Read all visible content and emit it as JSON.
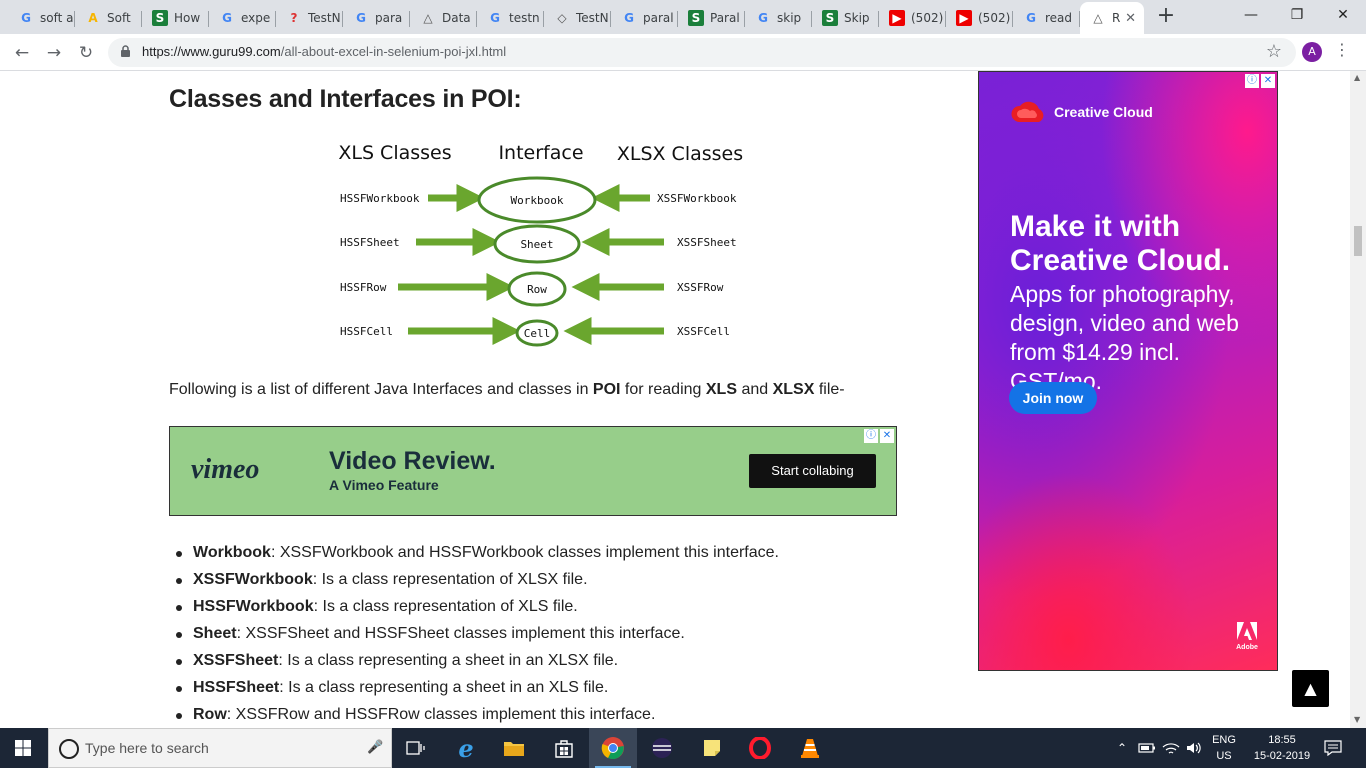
{
  "browser": {
    "tabs": [
      {
        "favicon": "google-icon",
        "title": "soft a"
      },
      {
        "favicon": "amp-icon",
        "title": "Soft"
      },
      {
        "favicon": "stm-icon",
        "title": "How"
      },
      {
        "favicon": "google-icon",
        "title": "expe"
      },
      {
        "favicon": "question-icon",
        "title": "TestN"
      },
      {
        "favicon": "google-icon",
        "title": "para"
      },
      {
        "favicon": "drive-icon",
        "title": "Data"
      },
      {
        "favicon": "google-icon",
        "title": "testn"
      },
      {
        "favicon": "testng-icon",
        "title": "TestN"
      },
      {
        "favicon": "google-icon",
        "title": "paral"
      },
      {
        "favicon": "stm-icon",
        "title": "Paral"
      },
      {
        "favicon": "google-icon",
        "title": "skip"
      },
      {
        "favicon": "stm-icon",
        "title": "Skip"
      },
      {
        "favicon": "youtube-icon",
        "title": "(502)"
      },
      {
        "favicon": "youtube-icon",
        "title": "(502)"
      },
      {
        "favicon": "google-icon",
        "title": "read"
      },
      {
        "favicon": "drive-icon",
        "title": "R",
        "active": true
      }
    ],
    "url_host": "https://www.guru99.com",
    "url_path": "/all-about-excel-in-selenium-poi-jxl.html",
    "profile_initial": "A"
  },
  "article": {
    "heading": "Classes and Interfaces in POI:",
    "diagram": {
      "col_left": "XLS Classes",
      "col_mid": "Interface",
      "col_right": "XLSX Classes",
      "rows": [
        {
          "left": "HSSFWorkbook",
          "mid": "Workbook",
          "right": "XSSFWorkbook"
        },
        {
          "left": "HSSFSheet",
          "mid": "Sheet",
          "right": "XSSFSheet"
        },
        {
          "left": "HSSFRow",
          "mid": "Row",
          "right": "XSSFRow"
        },
        {
          "left": "HSSFCell",
          "mid": "Cell",
          "right": "XSSFCell"
        }
      ]
    },
    "intro_a": "Following is a list of different Java Interfaces and classes in ",
    "intro_b1": "POI",
    "intro_c": " for reading ",
    "intro_b2": "XLS",
    "intro_d": " and ",
    "intro_b3": "XLSX",
    "intro_e": " file-",
    "bullets": [
      {
        "term": "Workbook",
        "text": ": XSSFWorkbook and HSSFWorkbook classes implement this interface."
      },
      {
        "term": "XSSFWorkbook",
        "text": ": Is a class representation of XLSX file."
      },
      {
        "term": "HSSFWorkbook",
        "text": ": Is a class representation of XLS file."
      },
      {
        "term": "Sheet",
        "text": ": XSSFSheet and HSSFSheet classes implement this interface."
      },
      {
        "term": "XSSFSheet",
        "text": ": Is a class representing a sheet in an XLSX file."
      },
      {
        "term": "HSSFSheet",
        "text": ": Is a class representing a sheet in an XLS file."
      },
      {
        "term": "Row",
        "text": ": XSSFRow and HSSFRow classes implement this interface."
      }
    ]
  },
  "vimeo_ad": {
    "logo": "vimeo",
    "title": "Video Review.",
    "subtitle": "A Vimeo Feature",
    "cta": "Start collabing"
  },
  "side_ad": {
    "brand": "Creative Cloud",
    "headline1": "Make it with",
    "headline2": "Creative Cloud.",
    "body1": "Apps for photography,",
    "body2": "design, video and web",
    "body3": "from $14.29 incl. GST/mo.",
    "cta": "Join now",
    "footer_logo": "Adobe"
  },
  "taskbar": {
    "search_placeholder": "Type here to search",
    "lang1": "ENG",
    "lang2": "US",
    "time": "18:55",
    "date": "15-02-2019"
  },
  "colors": {
    "arrow_green": "#6aa62e",
    "ellipse_green": "#4a8a2a",
    "vimeo_bg": "#97ce8a",
    "cta_blue": "#1473e6",
    "taskbar": "#1c2636"
  }
}
